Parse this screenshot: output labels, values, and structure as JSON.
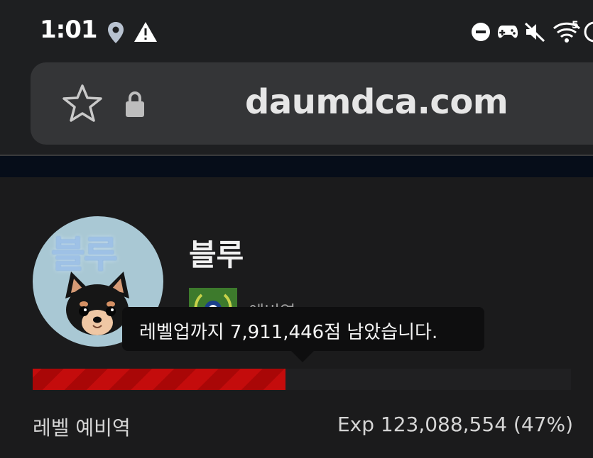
{
  "status_bar": {
    "time": "1:01",
    "icons": [
      "location-icon",
      "alert-icon",
      "dnd-icon",
      "gamepad-icon",
      "mute-icon",
      "wifi-icon",
      "battery-saver-icon"
    ],
    "wifi_badge": "5"
  },
  "browser": {
    "url": "daumdca.com",
    "bookmark_icon": "star-icon",
    "secure_icon": "lock-icon"
  },
  "profile": {
    "avatar_text": "블루",
    "username": "블루",
    "rank_name": "예비역",
    "tooltip": "레벨업까지 7,911,446점 남았습니다.",
    "level_label": "레벨 예비역",
    "exp_label": "Exp 123,088,554 (47%)",
    "exp_progress": 0.47
  },
  "colors": {
    "background": "#1b1b1c",
    "url_pill": "#343537",
    "exp_bar": "#c40c0c",
    "rank_badge": "#3d7a2c"
  }
}
